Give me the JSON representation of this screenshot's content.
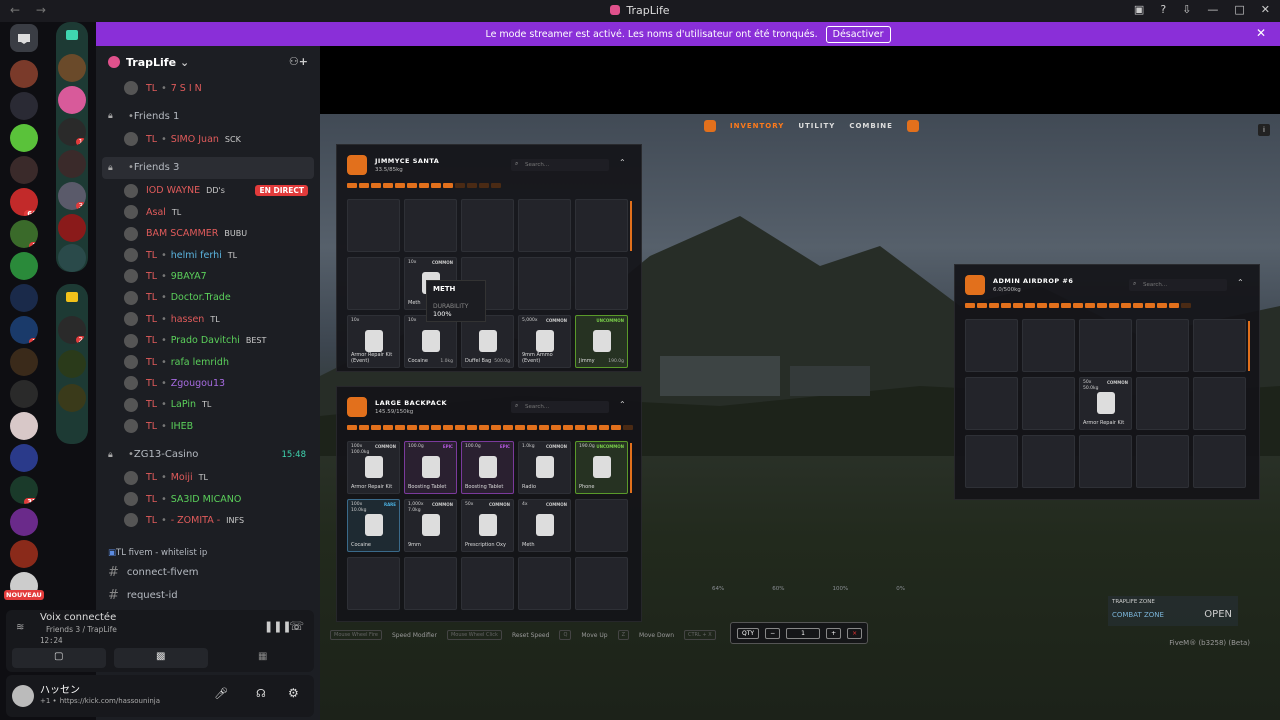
{
  "window": {
    "title": "TrapLife",
    "nav": "← →"
  },
  "streamer_banner": {
    "text": "Le mode streamer est activé. Les noms d'utilisateur ont été tronqués.",
    "button": "Désactiver"
  },
  "server": {
    "name": "TrapLife"
  },
  "server_badges": [
    "1",
    "66",
    "1",
    "3",
    "37"
  ],
  "folder_badges": [
    "1",
    "3",
    "2"
  ],
  "new_label": "NOUVEAU",
  "members_top": [
    {
      "tl": "TL",
      "name": "7 S I N"
    }
  ],
  "voice_channels": [
    {
      "name": "Friends 1",
      "members": [
        {
          "tl": "TL",
          "name": "SIMO Juan",
          "tag": "SCK",
          "name_color": "#e05b5b"
        }
      ]
    },
    {
      "name": "Friends 3",
      "members": [
        {
          "tl": "",
          "name": "IOD WAYNE",
          "tag": "DD's",
          "name_color": "#e05b5b",
          "live": "EN DIRECT"
        },
        {
          "tl": "",
          "name": "Asal",
          "tag": "TL",
          "name_color": "#e05b5b"
        },
        {
          "tl": "",
          "name": "BAM SCAMMER",
          "tag": "BUBU",
          "name_color": "#e05b5b"
        },
        {
          "tl": "TL",
          "name": "helmi ferhi",
          "tag": "TL",
          "name_color": "#5bb5e0"
        },
        {
          "tl": "TL",
          "name": "9BAYA7",
          "tag": "",
          "name_color": "#5bd05b"
        },
        {
          "tl": "TL",
          "name": "Doctor.Trade",
          "tag": "",
          "name_color": "#5bd05b"
        },
        {
          "tl": "TL",
          "name": "hassen",
          "tag": "TL",
          "name_color": "#e05b5b"
        },
        {
          "tl": "TL",
          "name": "Prado Davitchi",
          "tag": "BEST",
          "name_color": "#5bd05b"
        },
        {
          "tl": "TL",
          "name": "rafa lemridh",
          "tag": "",
          "name_color": "#5bd05b"
        },
        {
          "tl": "TL",
          "name": "Zgougou13",
          "tag": "",
          "name_color": "#a66be0"
        },
        {
          "tl": "TL",
          "name": "LaPin",
          "tag": "TL",
          "name_color": "#5bd05b"
        },
        {
          "tl": "TL",
          "name": "IHEB",
          "tag": "",
          "name_color": "#5bd05b"
        }
      ]
    },
    {
      "name": "ZG13-Casino",
      "time": "15:48",
      "members": [
        {
          "tl": "TL",
          "name": "Moiji",
          "tag": "TL",
          "name_color": "#e05b5b"
        },
        {
          "tl": "TL",
          "name": "SA3ID MICANO",
          "tag": "",
          "name_color": "#5bd05b"
        },
        {
          "tl": "TL",
          "name": "- ZOMITA -",
          "tag": "INFS",
          "name_color": "#e05b5b"
        }
      ]
    }
  ],
  "text_category": "TL fivem - whitelist ip",
  "text_channels": [
    "connect-fivem",
    "request-id"
  ],
  "voice_status": {
    "title": "Voix connectée",
    "channel": "Friends 3 / TrapLife",
    "time": "12:24"
  },
  "user": {
    "name": "ハッセン",
    "status": "https://kick.com/hassouninja",
    "status_prefix": "+1 •"
  },
  "game": {
    "tabs": [
      "INVENTORY",
      "UTILITY",
      "COMBINE"
    ],
    "player_inventory": {
      "title": "JIMMYCE SANTA",
      "weight": "33.5/85kg",
      "search_placeholder": "Search...",
      "weight_fill": 0.7,
      "slots": [
        {},
        {},
        {},
        {},
        {},
        {},
        {
          "count": "10x",
          "rarity": "COMMON",
          "label": "Meth"
        },
        {},
        {},
        {},
        {
          "count": "10x",
          "label": "Armor Repair Kit (Event)",
          "rarity": ""
        },
        {
          "count": "10x",
          "rarity": "COMMON",
          "label": "Cocaine",
          "weight": "1.0kg"
        },
        {
          "count": "",
          "label": "Duffel Bag",
          "weight": "500.0g"
        },
        {
          "count": "5,000x",
          "rarity": "COMMON",
          "label": "9mm Ammo (Event)"
        },
        {
          "count": "",
          "rarity": "UNCOMMON",
          "label": "Jimmy",
          "weight": "190.0g",
          "style": "green"
        }
      ]
    },
    "tooltip": {
      "name": "METH",
      "durability_label": "DURABILITY",
      "durability": "100%"
    },
    "backpack": {
      "title": "LARGE BACKPACK",
      "weight": "145.59/150kg",
      "search_placeholder": "Search...",
      "weight_fill": 0.97,
      "slots": [
        {
          "count": "100x",
          "sub": "100.0kg",
          "rarity": "COMMON",
          "label": "Armor Repair Kit"
        },
        {
          "count": "100.0g",
          "rarity": "EPIC",
          "label": "Boosting Tablet",
          "style": "purple"
        },
        {
          "count": "100.0g",
          "rarity": "EPIC",
          "label": "Boosting Tablet",
          "style": "purple"
        },
        {
          "count": "1.0kg",
          "rarity": "COMMON",
          "label": "Radio"
        },
        {
          "count": "190.0g",
          "rarity": "UNCOMMON",
          "label": "Phone",
          "style": "green"
        },
        {
          "count": "100x",
          "sub": "10.0kg",
          "rarity": "RARE",
          "label": "Cocaine",
          "style": "blue"
        },
        {
          "count": "1,000x",
          "sub": "7.0kg",
          "rarity": "COMMON",
          "label": "9mm"
        },
        {
          "count": "50x",
          "rarity": "COMMON",
          "label": "Prescription Oxy"
        },
        {
          "count": "4x",
          "rarity": "COMMON",
          "label": "Meth"
        },
        {},
        {},
        {},
        {},
        {},
        {}
      ]
    },
    "airdrop": {
      "title": "ADMIN AIRDROP #6",
      "weight": "6.0/500kg",
      "search_placeholder": "Search...",
      "weight_fill": 0.95,
      "slots": [
        {},
        {},
        {},
        {},
        {},
        {},
        {},
        {
          "count": "50x",
          "sub": "50.0kg",
          "rarity": "COMMON",
          "label": "Armor Repair Kit"
        },
        {},
        {},
        {},
        {},
        {},
        {},
        {}
      ]
    },
    "hints": [
      {
        "key": "Mouse Wheel Fire",
        "label": "Speed Modifier"
      },
      {
        "key": "Mouse Wheel Click",
        "label": "Reset Speed"
      },
      {
        "key": "Q",
        "label": "Move Up"
      },
      {
        "key": "Z",
        "label": "Move Down"
      },
      {
        "key": "CTRL + X",
        "label": ""
      }
    ],
    "qty": {
      "label": "QTY",
      "value": "1",
      "minus": "−",
      "plus": "+",
      "close": "×"
    },
    "stats": [
      "64%",
      "60%",
      "100%",
      "0%"
    ],
    "zone": {
      "title": "TRAPLIFE ZONE",
      "name": "COMBAT ZONE",
      "state": "OPEN"
    },
    "build": "FiveM® (b3258) (Beta)"
  },
  "colors": {
    "accent": "#e2701c",
    "discord_purple": "#8a2fd8",
    "live_red": "#e23b3b"
  }
}
